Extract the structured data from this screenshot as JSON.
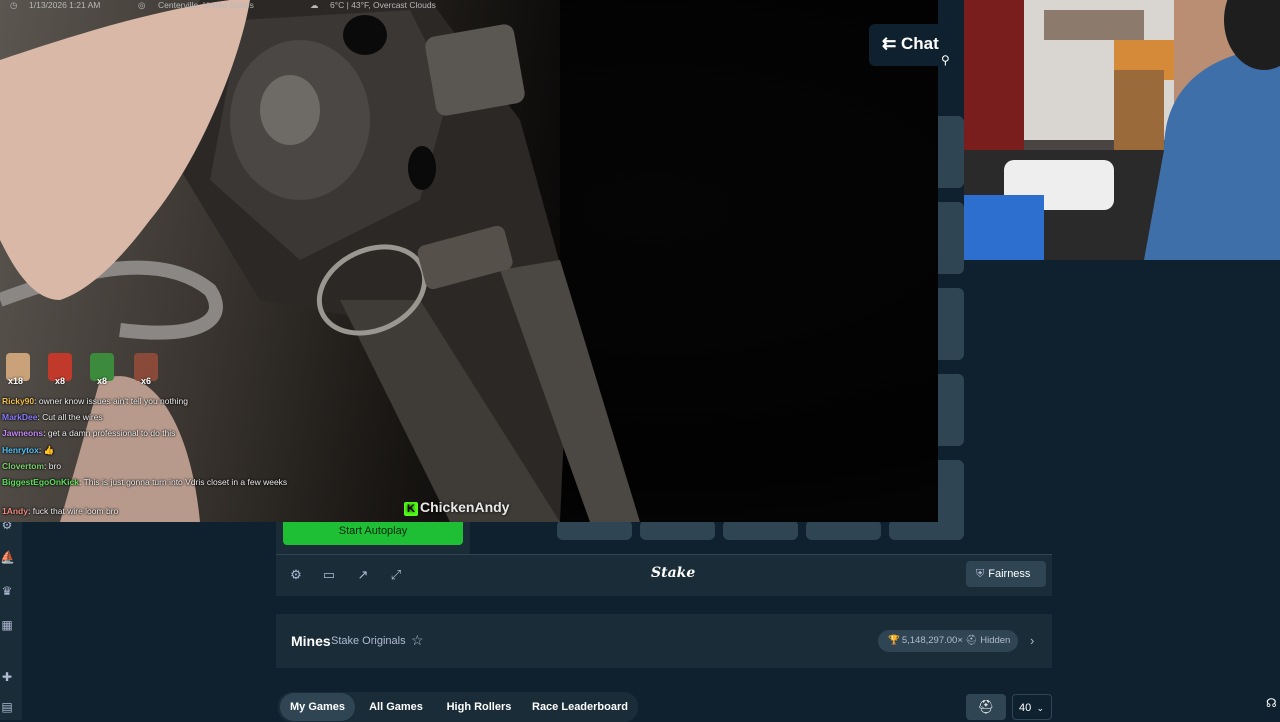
{
  "stream": {
    "status": {
      "datetime": "1/13/2026 1:21 AM",
      "location": "Centerville, United States",
      "weather": "6°C | 43°F, Overcast Clouds"
    },
    "emotes": [
      {
        "name": "emote-1",
        "count": "x18",
        "color": "#c9a27a"
      },
      {
        "name": "emote-2",
        "count": "x8",
        "color": "#c0392b"
      },
      {
        "name": "emote-3",
        "count": "x8",
        "color": "#3c8a3c"
      },
      {
        "name": "emote-4",
        "count": "x6",
        "color": "#8a4a3a"
      }
    ],
    "chat": [
      {
        "user": "Ricky90",
        "message": "owner know issues ain't tell you nothing",
        "color": "#f2c14e"
      },
      {
        "user": "MarkDee",
        "message": "Cut all the wires",
        "color": "#8a7dff"
      },
      {
        "user": "Jawneons",
        "message": "get a damn professional to do this",
        "color": "#c58af9"
      },
      {
        "user": "Henrytox",
        "message": "👍",
        "color": "#4fc3f7"
      },
      {
        "user": "Clovertom",
        "message": "bro",
        "color": "#7bd36c"
      },
      {
        "user": "BiggestEgoOnKick",
        "message": "This is just gonna turn into Vdris closet in a few weeks",
        "color": "#5ce15c"
      },
      {
        "user": "1Andy",
        "message": "fuck that wire loom bro",
        "color": "#f28b82"
      }
    ],
    "watermark": "ChickenAndy",
    "kick_badge": "K"
  },
  "chat_panel": {
    "label": "Chat"
  },
  "game": {
    "autoplay_label": "Start Autoplay",
    "logo": "Stake",
    "fairness_label": "Fairness",
    "title": "Mines",
    "subtitle": "Stake Originals",
    "record": "5,148,297.00×",
    "record_user": "Hidden"
  },
  "tabs": [
    {
      "label": "My Games",
      "active": true
    },
    {
      "label": "All Games",
      "active": false
    },
    {
      "label": "High Rollers",
      "active": false
    },
    {
      "label": "Race Leaderboard",
      "active": false
    }
  ],
  "page_size": "40",
  "colors": {
    "bg": "#0f212e",
    "panel": "#1a2c38",
    "tile": "#2f4553",
    "accent_green": "#1fbf35",
    "kick_green": "#53fc18"
  }
}
